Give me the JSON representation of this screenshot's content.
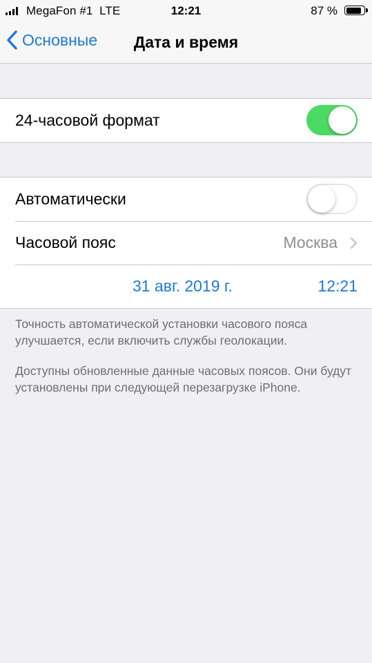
{
  "status_bar": {
    "carrier": "MegaFon #1  LTE",
    "time": "12:21",
    "battery_percent": "87 %",
    "battery_level": 0.87,
    "signal_icon": "signal-bars-icon",
    "battery_icon": "battery-icon"
  },
  "nav": {
    "back_label": "Основные",
    "back_icon": "chevron-left-icon",
    "title": "Дата и время"
  },
  "format_group": {
    "label": "24-часовой формат",
    "toggle_on": true
  },
  "time_group": {
    "auto_label": "Автоматически",
    "auto_on": false,
    "timezone_label": "Часовой пояс",
    "timezone_value": "Москва",
    "date": "31 авг. 2019 г.",
    "time": "12:21"
  },
  "footer": {
    "note1": "Точность автоматической установки часового пояса улучшается, если включить службы геолокации.",
    "note2": "Доступны обновленные данные часовых поясов. Они будут установлены при следующей перезагрузке iPhone."
  },
  "colors": {
    "accent": "#1c79d4",
    "toggle_on": "#4cd964",
    "background": "#efeff4",
    "secondary_text": "#8e8e93"
  }
}
